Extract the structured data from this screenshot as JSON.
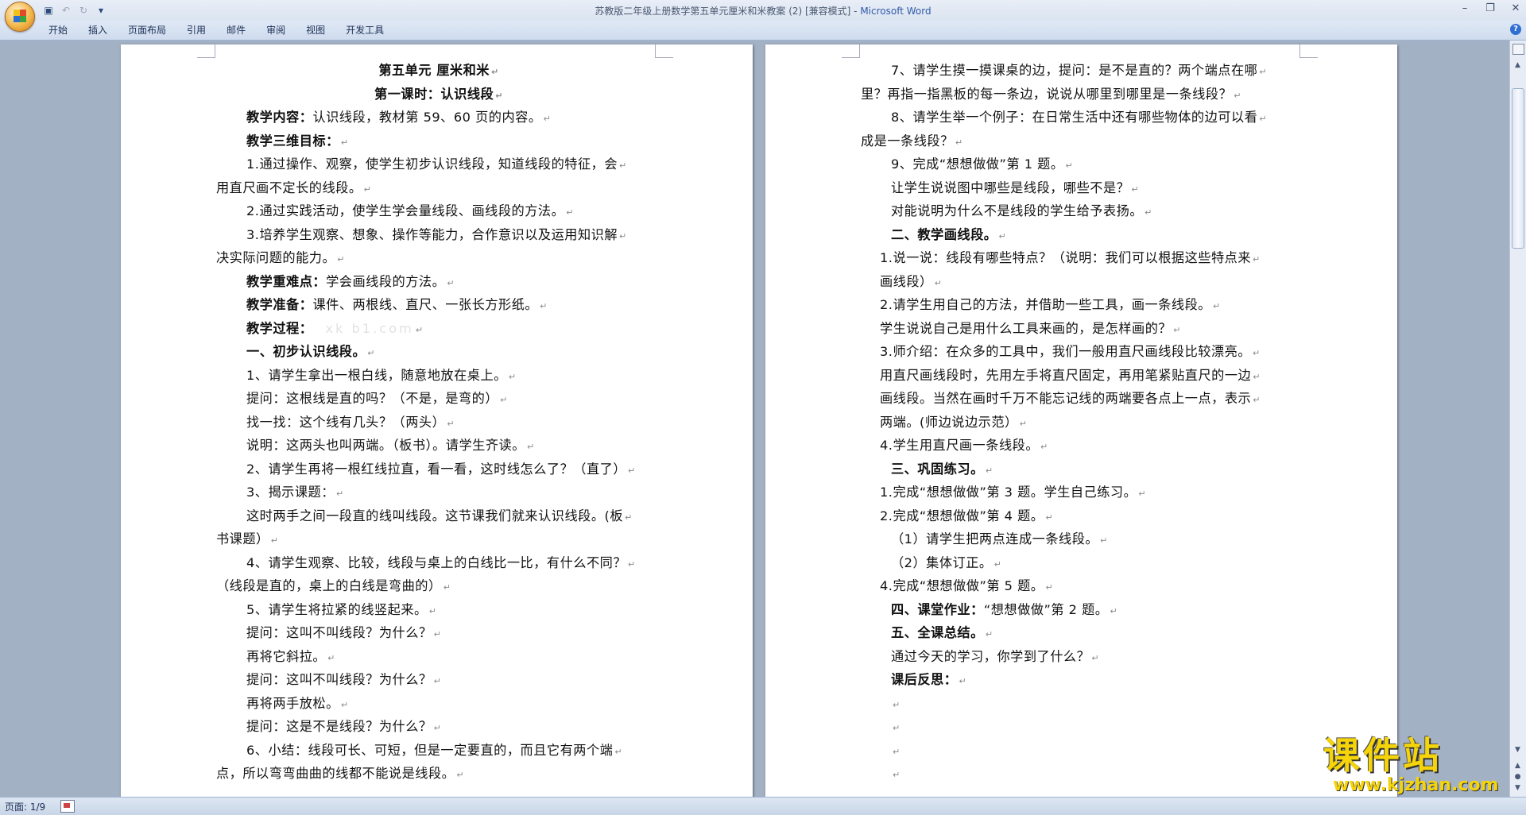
{
  "window": {
    "title_doc": "苏教版二年级上册数学第五单元厘米和米教案 (2) [兼容模式] - ",
    "title_app": "Microsoft Word"
  },
  "ribbon": {
    "tabs": [
      "开始",
      "插入",
      "页面布局",
      "引用",
      "邮件",
      "审阅",
      "视图",
      "开发工具"
    ]
  },
  "page1": {
    "lines": [
      {
        "t": "第五单元    厘米和米",
        "s": "center bold"
      },
      {
        "t": "第一课时：认识线段",
        "s": "center bold"
      },
      {
        "b": "教学内容：",
        "t": "认识线段，教材第 59、60 页的内容。",
        "s": "indent"
      },
      {
        "b": "教学三维目标：",
        "t": "",
        "s": "indent"
      },
      {
        "t": "1.通过操作、观察，使学生初步认识线段，知道线段的特征，会",
        "s": "indent"
      },
      {
        "t": "用直尺画不定长的线段。",
        "s": ""
      },
      {
        "t": "2.通过实践活动，使学生学会量线段、画线段的方法。",
        "s": "indent"
      },
      {
        "t": "3.培养学生观察、想象、操作等能力，合作意识以及运用知识解",
        "s": "indent"
      },
      {
        "t": "决实际问题的能力。",
        "s": ""
      },
      {
        "b": "教学重难点：",
        "t": "学会画线段的方法。",
        "s": "indent"
      },
      {
        "b": "教学准备：",
        "t": "课件、两根线、直尺、一张长方形纸。",
        "s": "indent"
      },
      {
        "b": "教学过程：",
        "t": "",
        "w": "xk b1.com",
        "s": "indent"
      },
      {
        "b": "一、初步认识线段。",
        "t": "",
        "s": "indent"
      },
      {
        "t": "1、请学生拿出一根白线，随意地放在桌上。",
        "s": "indent"
      },
      {
        "t": "提问：这根线是直的吗？（不是，是弯的）",
        "s": "indent"
      },
      {
        "t": "找一找：这个线有几头？（两头）",
        "s": "indent"
      },
      {
        "t": "说明：这两头也叫两端。（板书）。请学生齐读。",
        "s": "indent"
      },
      {
        "t": "2、请学生再将一根红线拉直，看一看，这时线怎么了？（直了）",
        "s": "indent"
      },
      {
        "t": "3、揭示课题：",
        "s": "indent"
      },
      {
        "t": "这时两手之间一段直的线叫线段。这节课我们就来认识线段。(板",
        "s": "indent"
      },
      {
        "t": "书课题）",
        "s": ""
      },
      {
        "t": "4、请学生观察、比较，线段与桌上的白线比一比，有什么不同？",
        "s": "indent"
      },
      {
        "t": "（线段是直的，桌上的白线是弯曲的）",
        "s": ""
      },
      {
        "t": "5、请学生将拉紧的线竖起来。",
        "s": "indent"
      },
      {
        "t": "提问：这叫不叫线段？为什么？",
        "s": "indent"
      },
      {
        "t": "再将它斜拉。",
        "s": "indent"
      },
      {
        "t": "提问：这叫不叫线段？为什么？",
        "s": "indent"
      },
      {
        "t": "再将两手放松。",
        "s": "indent"
      },
      {
        "t": "提问：这是不是线段？为什么？",
        "s": "indent"
      },
      {
        "t": "6、小结：线段可长、可短，但是一定要直的，而且它有两个端",
        "s": "indent"
      },
      {
        "t": "点，所以弯弯曲曲的线都不能说是线段。",
        "s": ""
      }
    ]
  },
  "page2": {
    "lines": [
      {
        "t": "7、请学生摸一摸课桌的边，提问：是不是直的？两个端点在哪",
        "s": "indent"
      },
      {
        "t": "里？再指一指黑板的每一条边，说说从哪里到哪里是一条线段？",
        "s": ""
      },
      {
        "t": "8、请学生举一个例子：在日常生活中还有哪些物体的边可以看",
        "s": "indent"
      },
      {
        "t": "成是一条线段？",
        "s": ""
      },
      {
        "t": "9、完成“想想做做”第 1 题。",
        "s": "indent"
      },
      {
        "t": "让学生说说图中哪些是线段，哪些不是？",
        "s": "indent"
      },
      {
        "t": "对能说明为什么不是线段的学生给予表扬。",
        "s": "indent"
      },
      {
        "b": "二、教学画线段。",
        "t": "",
        "s": "indent"
      },
      {
        "t": "1.说一说：线段有哪些特点？（说明：我们可以根据这些特点来",
        "s": "half"
      },
      {
        "t": "画线段）",
        "s": "half"
      },
      {
        "t": "2.请学生用自己的方法，并借助一些工具，画一条线段。",
        "s": "half"
      },
      {
        "t": "学生说说自己是用什么工具来画的，是怎样画的？",
        "s": "half"
      },
      {
        "t": "3.师介绍：在众多的工具中，我们一般用直尺画线段比较漂亮。",
        "s": "half"
      },
      {
        "t": "用直尺画线段时，先用左手将直尺固定，再用笔紧贴直尺的一边",
        "s": "half"
      },
      {
        "t": "画线段。当然在画时千万不能忘记线的两端要各点上一点，表示",
        "s": "half"
      },
      {
        "t": "两端。(师边说边示范）",
        "s": "half"
      },
      {
        "t": "4.学生用直尺画一条线段。",
        "s": "half"
      },
      {
        "b": "三、巩固练习。",
        "t": "",
        "s": "indent"
      },
      {
        "t": "1.完成“想想做做”第 3 题。学生自己练习。",
        "s": "half"
      },
      {
        "t": "2.完成“想想做做”第 4 题。",
        "s": "half"
      },
      {
        "t": "（1）请学生把两点连成一条线段。",
        "s": "indent"
      },
      {
        "t": "（2）集体订正。",
        "s": "indent"
      },
      {
        "t": "4.完成“想想做做”第 5 题。",
        "s": "half"
      },
      {
        "b": "四、课堂作业：",
        "t": "“想想做做”第 2 题。",
        "s": "indent"
      },
      {
        "b": "五、全课总结。",
        "t": "",
        "s": "indent"
      },
      {
        "t": "通过今天的学习，你学到了什么？",
        "s": "indent"
      },
      {
        "b": "课后反思：",
        "t": "",
        "s": "indent"
      },
      {
        "t": "",
        "s": "indent"
      },
      {
        "t": "",
        "s": "indent"
      },
      {
        "t": "",
        "s": "indent"
      },
      {
        "t": "",
        "s": "indent"
      }
    ]
  },
  "paragraph_mark": "↵",
  "status": {
    "page": "页面: 1/9"
  },
  "watermark_logo": {
    "main": "课件站",
    "url": "www.kjzhan.com"
  }
}
